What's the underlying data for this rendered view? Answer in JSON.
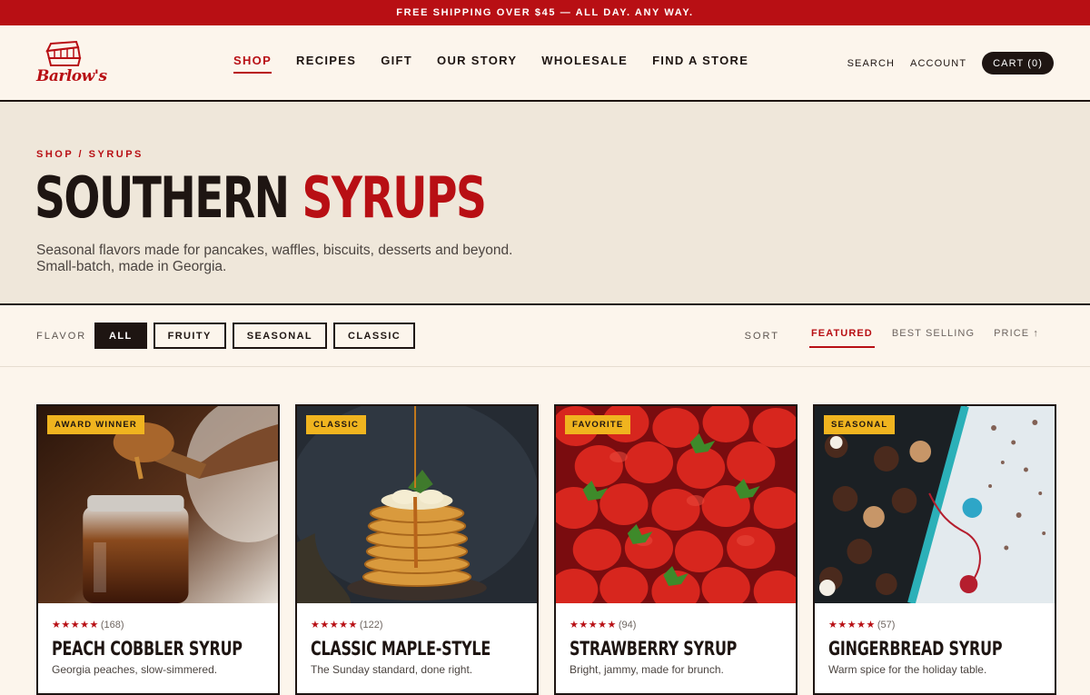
{
  "promo": "FREE SHIPPING OVER $45 — ALL DAY. ANY WAY.",
  "brand": {
    "name": "Barlow's"
  },
  "nav": [
    "SHOP",
    "RECIPES",
    "GIFT",
    "OUR STORY",
    "WHOLESALE",
    "FIND A STORE"
  ],
  "header": {
    "search": "SEARCH",
    "account": "ACCOUNT",
    "cart": "CART (0)"
  },
  "hero": {
    "crumb_shop": "SHOP",
    "crumb_sep": " / ",
    "crumb_current": "SYRUPS",
    "title_a": "SOUTHERN",
    "title_b": "SYRUPS",
    "subtitle": "Seasonal flavors made for pancakes, waffles, biscuits, desserts and beyond. Small-batch, made in Georgia."
  },
  "filters": {
    "label": "FLAVOR",
    "options": [
      "ALL",
      "FRUITY",
      "SEASONAL",
      "CLASSIC"
    ],
    "active": "ALL"
  },
  "sort": {
    "label": "SORT",
    "options": [
      "FEATURED",
      "BEST SELLING",
      "PRICE ↑"
    ],
    "active": "FEATURED"
  },
  "products": [
    {
      "badge": "AWARD WINNER",
      "stars": "★★★★★",
      "reviews": "(168)",
      "name": "PEACH COBBLER SYRUP",
      "desc": "Georgia peaches, slow-simmered.",
      "image": "honey-jar-dipper"
    },
    {
      "badge": "CLASSIC",
      "stars": "★★★★★",
      "reviews": "(122)",
      "name": "CLASSIC MAPLE-STYLE",
      "desc": "The Sunday standard, done right.",
      "image": "pancake-stack"
    },
    {
      "badge": "FAVORITE",
      "stars": "★★★★★",
      "reviews": "(94)",
      "name": "STRAWBERRY SYRUP",
      "desc": "Bright, jammy, made for brunch.",
      "image": "strawberries"
    },
    {
      "badge": "SEASONAL",
      "stars": "★★★★★",
      "reviews": "(57)",
      "name": "GINGERBREAD SYRUP",
      "desc": "Warm spice for the holiday table.",
      "image": "chocolate-box"
    }
  ]
}
